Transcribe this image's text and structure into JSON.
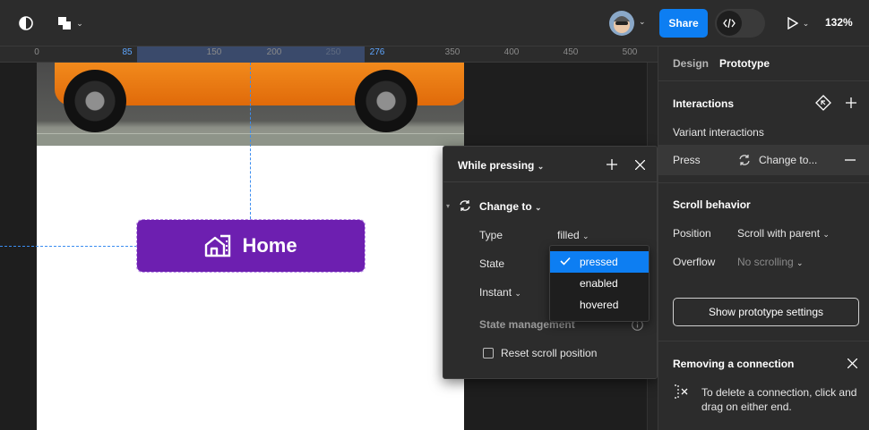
{
  "toolbar": {
    "share_label": "Share",
    "zoom_label": "132%",
    "icons": [
      "main-menu-icon",
      "shape-tools-icon",
      "code-icon",
      "play-icon"
    ]
  },
  "ruler": {
    "ticks": [
      {
        "label": "0",
        "highlight": false
      },
      {
        "label": "85",
        "highlight": true
      },
      {
        "label": "150",
        "highlight": false
      },
      {
        "label": "200",
        "highlight": false
      },
      {
        "label": "250",
        "highlight": false
      },
      {
        "label": "276",
        "highlight": true
      },
      {
        "label": "350",
        "highlight": false
      },
      {
        "label": "400",
        "highlight": false
      },
      {
        "label": "450",
        "highlight": false
      },
      {
        "label": "500",
        "highlight": false
      }
    ]
  },
  "canvas": {
    "button_label": "Home",
    "button_color": "#6d1fb0"
  },
  "popup": {
    "title": "While pressing",
    "action_label": "Change to",
    "type_label": "Type",
    "type_value": "filled",
    "state_label": "State",
    "transition_value": "Instant",
    "state_management_label": "State management",
    "reset_scroll_label": "Reset scroll position",
    "state_options": [
      {
        "label": "pressed",
        "selected": true
      },
      {
        "label": "enabled",
        "selected": false
      },
      {
        "label": "hovered",
        "selected": false
      }
    ]
  },
  "panel": {
    "tabs": {
      "design": "Design",
      "prototype": "Prototype"
    },
    "interactions_title": "Interactions",
    "variant_interactions_label": "Variant interactions",
    "press_trigger": "Press",
    "press_action": "Change to...",
    "scroll_behavior_title": "Scroll behavior",
    "position_label": "Position",
    "position_value": "Scroll with parent",
    "overflow_label": "Overflow",
    "overflow_value": "No scrolling",
    "settings_button": "Show prototype settings",
    "tip_title": "Removing a connection",
    "tip_text_1": "To delete a connection, click and",
    "tip_text_2": "drag on either end."
  },
  "colors": {
    "accent": "#0d7ef2",
    "guide": "#3b8df0"
  }
}
